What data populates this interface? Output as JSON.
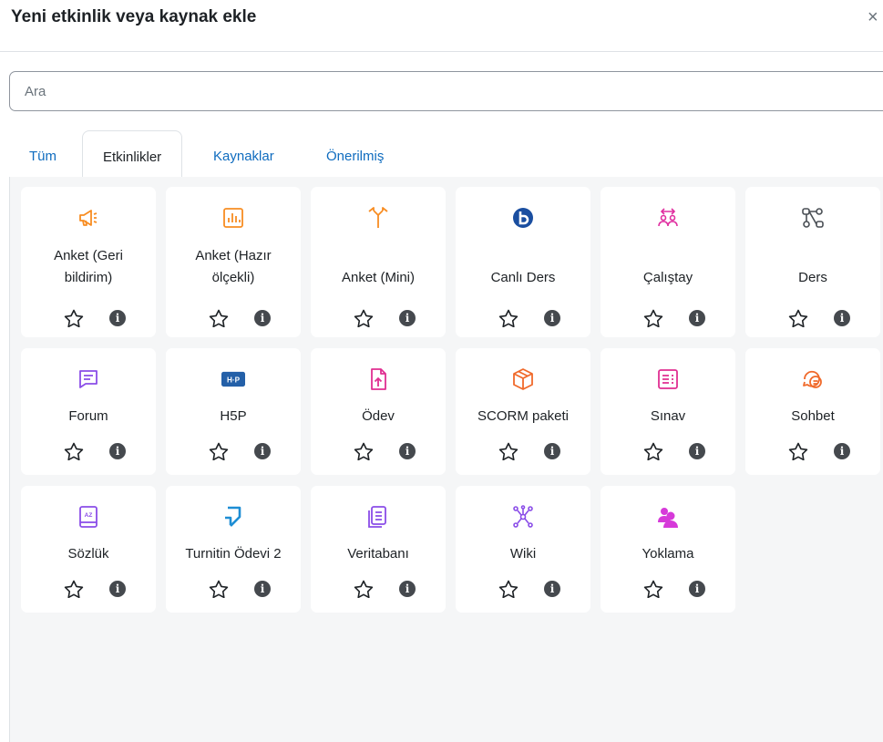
{
  "modal": {
    "title": "Yeni etkinlik veya kaynak ekle",
    "close_icon": "close-icon",
    "close_glyph": "×"
  },
  "search": {
    "placeholder": "Ara",
    "value": ""
  },
  "tabs": [
    {
      "label": "Tüm",
      "active": false
    },
    {
      "label": "Etkinlikler",
      "active": true
    },
    {
      "label": "Kaynaklar",
      "active": false
    },
    {
      "label": "Önerilmiş",
      "active": false
    }
  ],
  "colors": {
    "orange": "#f7634d",
    "pink": "#eb66a2",
    "blue": "#399be2",
    "purple": "#a378ff",
    "bbb": "#1a4ea0",
    "h5p": "#2460a8",
    "turnitin": "#1e8ed4",
    "info": "#45494e"
  },
  "items": [
    {
      "name": "Anket (Geri bildirim)",
      "icon": "megaphone-icon",
      "color": "#f88d22",
      "favorite": false
    },
    {
      "name": "Anket (Hazır ölçekli)",
      "icon": "chart-icon",
      "color": "#f88d22",
      "favorite": false
    },
    {
      "name": "Anket (Mini)",
      "icon": "signpost-icon",
      "color": "#f88d22",
      "favorite": false
    },
    {
      "name": "Canlı Ders",
      "icon": "bigbluebutton-icon",
      "color": "#1a4ea0",
      "favorite": false
    },
    {
      "name": "Çalıştay",
      "icon": "workshop-icon",
      "color": "#e02fa0",
      "favorite": false
    },
    {
      "name": "Ders",
      "icon": "lesson-icon",
      "color": "#4a4f55",
      "favorite": false
    },
    {
      "name": "Forum",
      "icon": "forum-icon",
      "color": "#8a4de8",
      "favorite": false
    },
    {
      "name": "H5P",
      "icon": "h5p-icon",
      "color": "#2460a8",
      "favorite": false
    },
    {
      "name": "Ödev",
      "icon": "assignment-icon",
      "color": "#e02f91",
      "favorite": false
    },
    {
      "name": "SCORM paketi",
      "icon": "package-icon",
      "color": "#f06a2b",
      "favorite": false
    },
    {
      "name": "Sınav",
      "icon": "quiz-icon",
      "color": "#e02f91",
      "favorite": false
    },
    {
      "name": "Sohbet",
      "icon": "chat-icon",
      "color": "#f06a2b",
      "favorite": false
    },
    {
      "name": "Sözlük",
      "icon": "glossary-icon",
      "color": "#8a4de8",
      "favorite": false
    },
    {
      "name": "Turnitin Ödevi 2",
      "icon": "turnitin-icon",
      "color": "#1e8ed4",
      "favorite": false
    },
    {
      "name": "Veritabanı",
      "icon": "database-icon",
      "color": "#8a4de8",
      "favorite": false
    },
    {
      "name": "Wiki",
      "icon": "wiki-icon",
      "color": "#8a4de8",
      "favorite": false
    },
    {
      "name": "Yoklama",
      "icon": "attendance-icon",
      "color": "#d63ad9",
      "favorite": false
    }
  ],
  "card_actions": {
    "star_icon": "star-icon",
    "info_icon": "info-icon",
    "info_glyph": "i"
  }
}
